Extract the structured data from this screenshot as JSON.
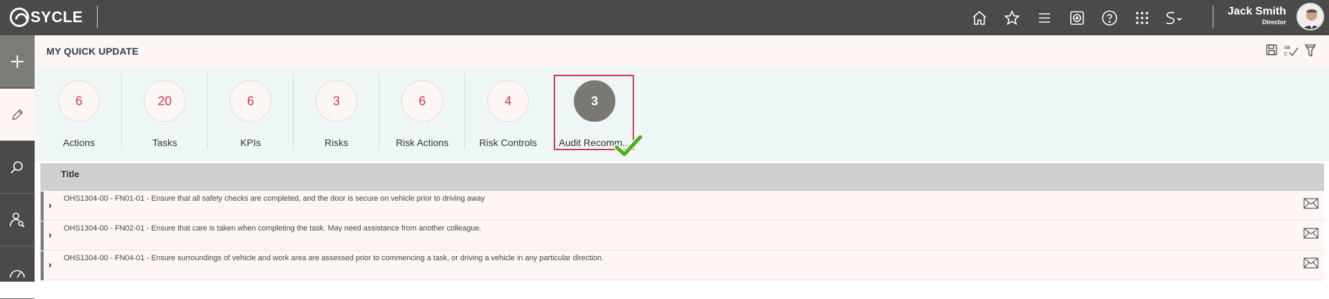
{
  "app": {
    "logo_text": "SYCLE",
    "user": {
      "name": "Jack Smith",
      "role": "Director"
    },
    "top_icons": [
      "home-icon",
      "star-icon",
      "menu-icon",
      "target-icon",
      "help-icon",
      "apps-grid-icon",
      "sycle-switch-icon"
    ]
  },
  "leftrail": {
    "items": [
      "add-icon",
      "pencil-icon",
      "search-icon",
      "user-search-icon",
      "gauge-icon"
    ],
    "active": "pencil-icon"
  },
  "page": {
    "title": "MY QUICK UPDATE",
    "tools": [
      "save-icon",
      "spellcheck-icon",
      "filter-icon"
    ]
  },
  "tiles": [
    {
      "count": "6",
      "label": "Actions"
    },
    {
      "count": "20",
      "label": "Tasks"
    },
    {
      "count": "6",
      "label": "KPIs"
    },
    {
      "count": "3",
      "label": "Risks"
    },
    {
      "count": "6",
      "label": "Risk Actions"
    },
    {
      "count": "4",
      "label": "Risk Controls"
    },
    {
      "count": "3",
      "label": "Audit Recomm..."
    }
  ],
  "active_tile": "Audit Recomm...",
  "table": {
    "header": "Title",
    "rows": [
      {
        "title": "OHS1304-00 - FN01-01 - Ensure that all safety checks are completed, and the door is secure on vehicle prior to driving away"
      },
      {
        "title": "OHS1304-00 - FN02-01 - Ensure that care is taken when completing the task. May need assistance from another colleague."
      },
      {
        "title": "OHS1304-00 - FN04-01 - Ensure surroundings of vehicle and work area are assessed prior to commencing a task, or driving a vehicle in any particular direction."
      }
    ]
  },
  "colors": {
    "topbar": "#4b4a48",
    "accent_red": "#d5374a",
    "active_tile": "#7a7872",
    "check_green": "#4caf24"
  }
}
